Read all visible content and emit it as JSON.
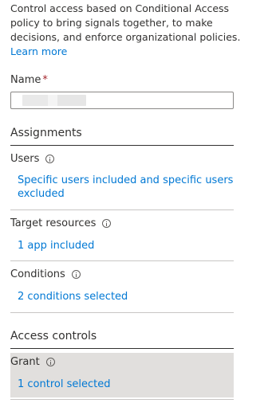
{
  "intro": {
    "line1": "Control access based on Conditional Access",
    "line2": "policy to bring signals together, to make",
    "line3": "decisions, and enforce organizational policies.",
    "learn_more": "Learn more"
  },
  "name_field": {
    "label": "Name",
    "required_mark": "*",
    "value": ""
  },
  "assignments": {
    "header": "Assignments",
    "users": {
      "label": "Users",
      "link_line1": "Specific users included and specific users",
      "link_line2": "excluded"
    },
    "target_resources": {
      "label": "Target resources",
      "link": "1 app included"
    },
    "conditions": {
      "label": "Conditions",
      "link": "2 conditions selected"
    }
  },
  "access_controls": {
    "header": "Access controls",
    "grant": {
      "label": "Grant",
      "link": "1 control selected"
    }
  },
  "colors": {
    "link": "#0078d4",
    "text": "#323130",
    "required": "#a4262c",
    "selected_bg": "#e1dfdd"
  }
}
